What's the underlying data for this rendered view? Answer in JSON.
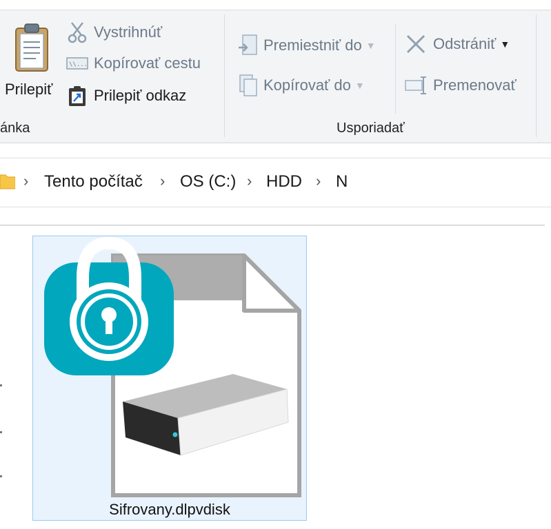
{
  "ribbon": {
    "clipboard": {
      "paste_label": "Prilepiť",
      "cut_label": "Vystrihnúť",
      "copy_path_label": "Kopírovať cestu",
      "paste_shortcut_label": "Prilepiť odkaz",
      "group_label": "ánka"
    },
    "organize": {
      "move_to_label": "Premiestniť do",
      "copy_to_label": "Kopírovať do",
      "delete_label": "Odstrániť",
      "rename_label": "Premenovať",
      "group_label": "Usporiadať"
    }
  },
  "address_bar": {
    "folder_icon": "folder-icon",
    "crumbs": [
      "Tento počítač",
      "OS (C:)",
      "HDD",
      "N"
    ]
  },
  "files": [
    {
      "name": "Sifrovany.dlpvdisk",
      "icon": "encrypted-disk-file-icon",
      "selected": true
    }
  ],
  "colors": {
    "accent_teal": "#00a7bd",
    "selection_bg": "#e9f3fd",
    "selection_border": "#99c9f2",
    "ribbon_bg": "#f3f4f6"
  }
}
